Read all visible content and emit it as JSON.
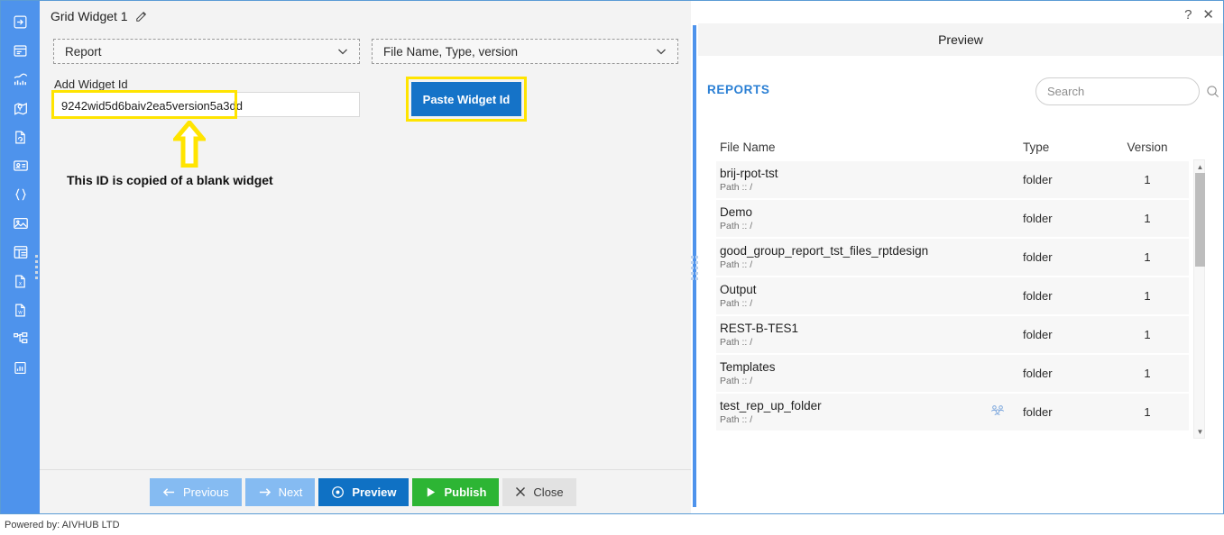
{
  "window": {
    "title": "Grid Widget 1",
    "edit_icon": "pencil-edit-icon",
    "help_label": "?",
    "close_label": "✕"
  },
  "sidebar": {
    "items": [
      {
        "icon": "login-arrow-icon",
        "name": "sidebar-item-login"
      },
      {
        "icon": "form-layout-icon",
        "name": "sidebar-item-form"
      },
      {
        "icon": "analytics-chart-icon",
        "name": "sidebar-item-analytics"
      },
      {
        "icon": "map-pin-icon",
        "name": "sidebar-item-map"
      },
      {
        "icon": "document-refresh-icon",
        "name": "sidebar-item-document"
      },
      {
        "icon": "id-card-icon",
        "name": "sidebar-item-card"
      },
      {
        "icon": "code-braces-icon",
        "name": "sidebar-item-code"
      },
      {
        "icon": "image-picture-icon",
        "name": "sidebar-item-image"
      },
      {
        "icon": "grid-widget-icon",
        "name": "sidebar-item-grid"
      },
      {
        "icon": "excel-file-icon",
        "name": "sidebar-item-excel"
      },
      {
        "icon": "word-file-icon",
        "name": "sidebar-item-word"
      },
      {
        "icon": "tree-hierarchy-icon",
        "name": "sidebar-item-tree"
      },
      {
        "icon": "bar-chart-icon",
        "name": "sidebar-item-report"
      }
    ]
  },
  "editor": {
    "source_dropdown": {
      "value": "Report",
      "chevron": "chevron-down-icon"
    },
    "columns_dropdown": {
      "value": "File Name, Type, version",
      "chevron": "chevron-down-icon"
    },
    "widget_id_label": "Add Widget Id",
    "widget_id_value": "9242wid5d6baiv2ea5version5a3dd",
    "widget_id_placeholder": "Add Widget Id",
    "paste_button": "Paste Widget Id",
    "annotation_text": "This ID is copied of a blank widget",
    "highlight_color": "#ffe400",
    "buttons": [
      {
        "label": "Previous",
        "icon": "arrow-left-icon",
        "style": "light",
        "name": "previous-button"
      },
      {
        "label": "Next",
        "icon": "arrow-right-icon",
        "style": "light",
        "name": "next-button"
      },
      {
        "label": "Preview",
        "icon": "eye-icon",
        "style": "primary",
        "name": "preview-button"
      },
      {
        "label": "Publish",
        "icon": "play-icon",
        "style": "green",
        "name": "publish-button"
      },
      {
        "label": "Close",
        "icon": "close-x-icon",
        "style": "grey",
        "name": "close-button"
      }
    ]
  },
  "preview": {
    "heading": "Preview",
    "section_label": "REPORTS",
    "search": {
      "value": "",
      "placeholder": "Search",
      "icon": "search-icon"
    },
    "table": {
      "columns": [
        "File Name",
        "Type",
        "Version"
      ],
      "rows": [
        {
          "name": "brij-rpot-tst",
          "path": "Path :: /",
          "type": "folder",
          "version": "1",
          "shared": false
        },
        {
          "name": "Demo",
          "path": "Path :: /",
          "type": "folder",
          "version": "1",
          "shared": false
        },
        {
          "name": "good_group_report_tst_files_rptdesign",
          "path": "Path :: /",
          "type": "folder",
          "version": "1",
          "shared": false
        },
        {
          "name": "Output",
          "path": "Path :: /",
          "type": "folder",
          "version": "1",
          "shared": false
        },
        {
          "name": "REST-B-TES1",
          "path": "Path :: /",
          "type": "folder",
          "version": "1",
          "shared": false
        },
        {
          "name": "Templates",
          "path": "Path :: /",
          "type": "folder",
          "version": "1",
          "shared": false
        },
        {
          "name": "test_rep_up_folder",
          "path": "Path :: /",
          "type": "folder",
          "version": "1",
          "shared": true
        }
      ]
    }
  },
  "footer": {
    "text": "Powered by: AIVHUB LTD"
  },
  "colors": {
    "sidebar_blue": "#4e93ec",
    "accent_blue": "#0f71c4",
    "publish_green": "#2db534",
    "highlight_yellow": "#ffe400",
    "link_blue": "#2a7fd4"
  }
}
